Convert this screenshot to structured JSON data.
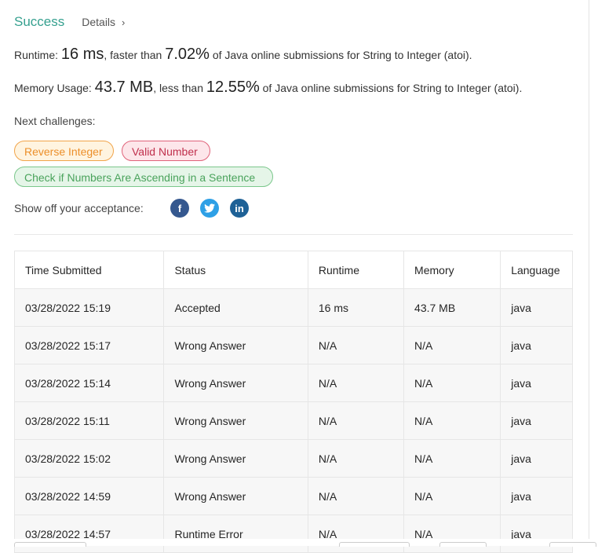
{
  "header": {
    "status": "Success",
    "details_label": "Details"
  },
  "runtime": {
    "label": "Runtime: ",
    "value": "16 ms",
    "mid": ", faster than ",
    "percent": "7.02%",
    "tail": " of Java online submissions for String to Integer (atoi)."
  },
  "memory": {
    "label": "Memory Usage: ",
    "value": "43.7 MB",
    "mid": ", less than ",
    "percent": "12.55%",
    "tail": " of Java online submissions for String to Integer (atoi)."
  },
  "next": {
    "label": "Next challenges:",
    "items": [
      "Reverse Integer",
      "Valid Number",
      "Check if Numbers Are Ascending in a Sentence"
    ]
  },
  "share": {
    "label": "Show off your acceptance:",
    "icons": [
      "facebook-icon",
      "twitter-icon",
      "linkedin-icon"
    ]
  },
  "table": {
    "headers": [
      "Time Submitted",
      "Status",
      "Runtime",
      "Memory",
      "Language"
    ],
    "rows": [
      [
        "03/28/2022 15:19",
        "Accepted",
        "16 ms",
        "43.7 MB",
        "java"
      ],
      [
        "03/28/2022 15:17",
        "Wrong Answer",
        "N/A",
        "N/A",
        "java"
      ],
      [
        "03/28/2022 15:14",
        "Wrong Answer",
        "N/A",
        "N/A",
        "java"
      ],
      [
        "03/28/2022 15:11",
        "Wrong Answer",
        "N/A",
        "N/A",
        "java"
      ],
      [
        "03/28/2022 15:02",
        "Wrong Answer",
        "N/A",
        "N/A",
        "java"
      ],
      [
        "03/28/2022 14:59",
        "Wrong Answer",
        "N/A",
        "N/A",
        "java"
      ],
      [
        "03/28/2022 14:57",
        "Runtime Error",
        "N/A",
        "N/A",
        "java"
      ]
    ]
  },
  "colors": {
    "accent": "#35a08f",
    "error": "#d32f2f"
  }
}
